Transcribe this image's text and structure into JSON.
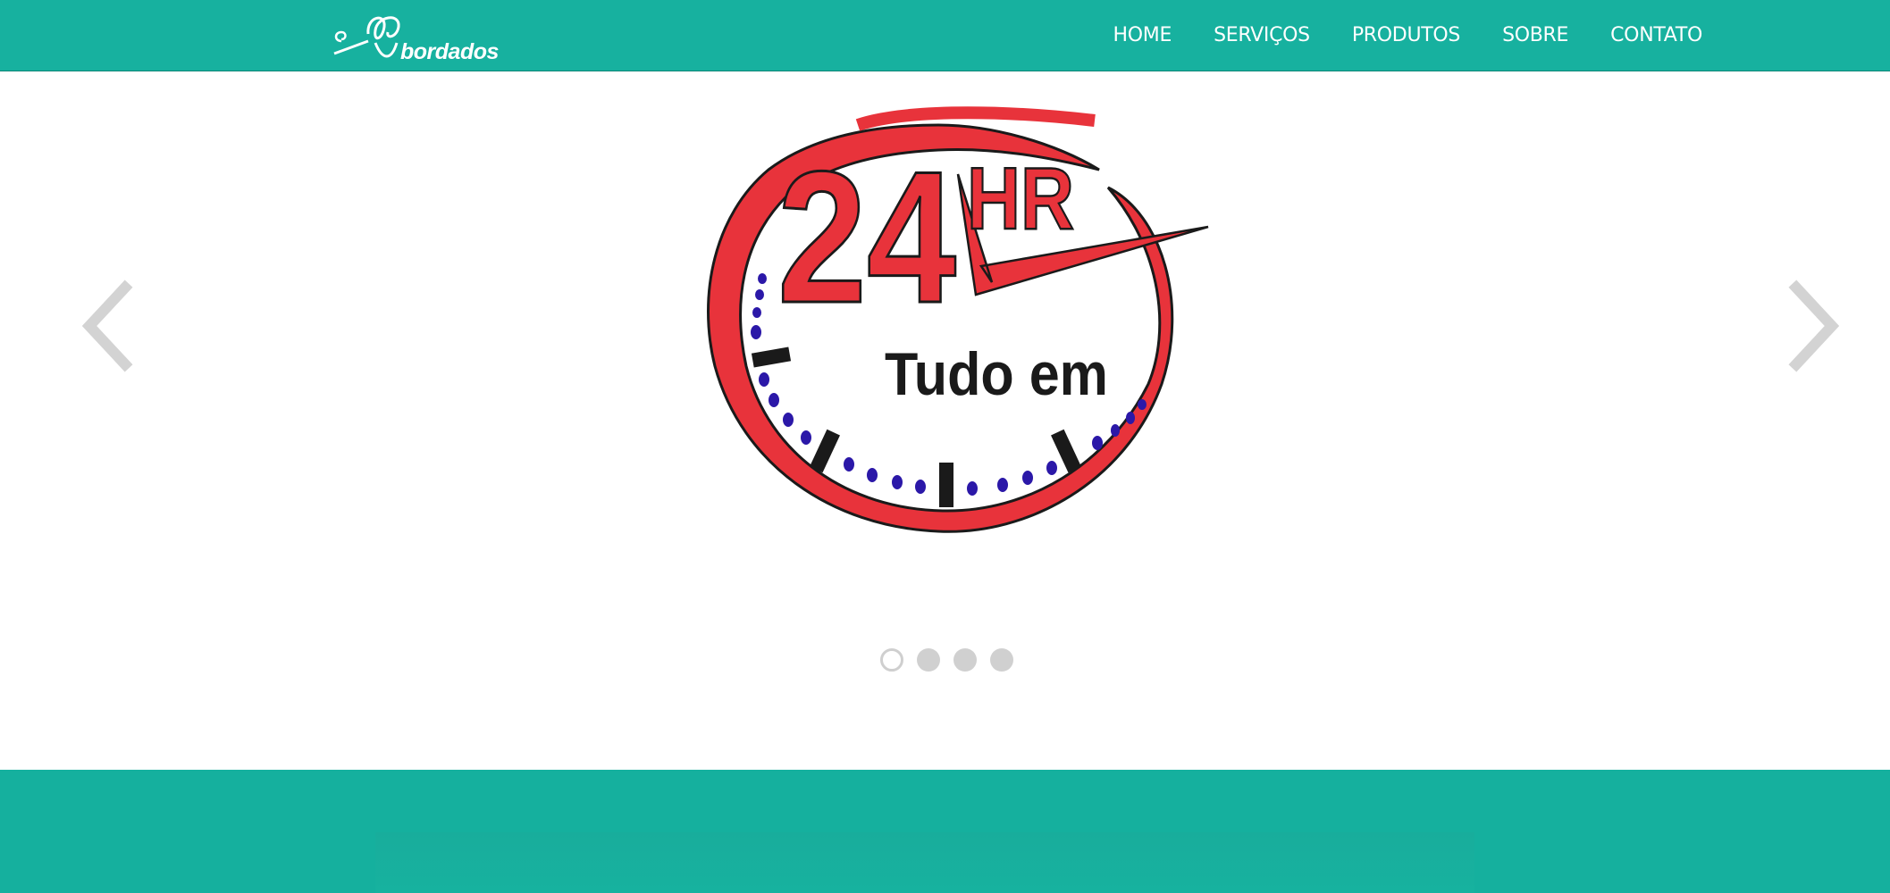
{
  "brand": {
    "logo_text": "bordados"
  },
  "nav": {
    "items": [
      "HOME",
      "SERVIÇOS",
      "PRODUTOS",
      "SOBRE",
      "CONTATO"
    ]
  },
  "carousel": {
    "slide_badge_number": "24",
    "slide_badge_unit": "HR",
    "slide_caption": "Tudo em",
    "slide_count": 4,
    "active_index": 0
  },
  "colors": {
    "brand_teal": "#17b19f",
    "clock_red": "#e8333b",
    "dot_blue": "#2b18a8"
  }
}
